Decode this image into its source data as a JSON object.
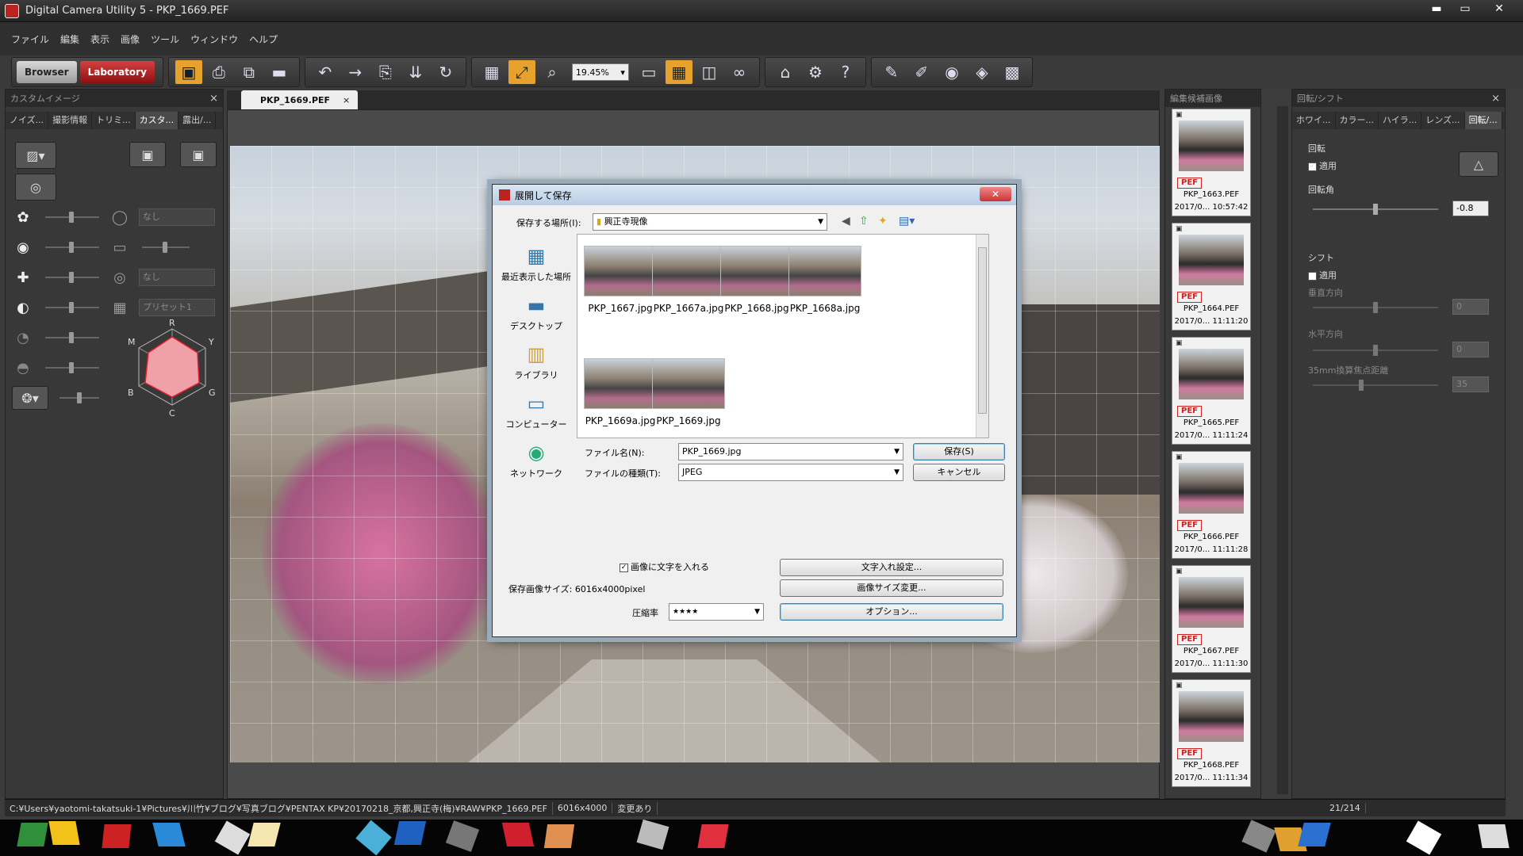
{
  "window": {
    "title": "Digital Camera Utility 5 - PKP_1669.PEF",
    "min": "▬",
    "max": "▭",
    "close": "✕"
  },
  "menu": [
    "ファイル",
    "編集",
    "表示",
    "画像",
    "ツール",
    "ウィンドウ",
    "ヘルプ"
  ],
  "toolbar": {
    "browser": "Browser",
    "laboratory": "Laboratory",
    "zoom": "19.45%"
  },
  "left_panel": {
    "title": "カスタムイメージ",
    "close": "×",
    "tabs": [
      "ノイズ...",
      "撮影情報",
      "トリミ...",
      "カスタ...",
      "露出/..."
    ],
    "active_tab": 3,
    "rows": [
      {
        "icon": "RGB",
        "select": "なし"
      },
      {
        "icon": "◉",
        "select": ""
      },
      {
        "icon": "✚",
        "select": "なし"
      },
      {
        "icon": "◐",
        "select": "プリセット1"
      },
      {
        "icon": "◔",
        "select": ""
      },
      {
        "icon": "◓",
        "select": ""
      }
    ],
    "radar_labels": {
      "r": "R",
      "y": "Y",
      "g": "G",
      "c": "C",
      "b": "B",
      "m": "M"
    },
    "colors": {
      "radar_fill": "#f0a0a8",
      "radar_line": "#e02030"
    }
  },
  "document_tab": {
    "label": "PKP_1669.PEF",
    "close": "×"
  },
  "dialog": {
    "title": "展開して保存",
    "close": "✕",
    "save_in_label": "保存する場所(I):",
    "save_in_value": "興正寺現像",
    "places": [
      "最近表示した場所",
      "デスクトップ",
      "ライブラリ",
      "コンピューター",
      "ネットワーク"
    ],
    "files": [
      "PKP_1667.jpg",
      "PKP_1667a.jpg",
      "PKP_1668.jpg",
      "PKP_1668a.jpg",
      "PKP_1669a.jpg",
      "PKP_1669.jpg"
    ],
    "filename_label": "ファイル名(N):",
    "filename_value": "PKP_1669.jpg",
    "filetype_label": "ファイルの種類(T):",
    "filetype_value": "JPEG",
    "save_button": "保存(S)",
    "cancel_button": "キャンセル",
    "text_checkbox": "画像に文字を入れる",
    "text_checked": "✓",
    "text_settings_button": "文字入れ設定...",
    "size_label": "保存画像サイズ:",
    "size_value": "6016x4000pixel",
    "resize_button": "画像サイズ変更...",
    "compression_label": "圧縮率",
    "compression_value": "★★★★",
    "options_button": "オプション..."
  },
  "filmstrip": {
    "title": "編集候補画像",
    "items": [
      {
        "name": "PKP_1663.PEF",
        "date": "2017/0...  10:57:42",
        "badge": "PEF"
      },
      {
        "name": "PKP_1664.PEF",
        "date": "2017/0...  11:11:20",
        "badge": "PEF"
      },
      {
        "name": "PKP_1665.PEF",
        "date": "2017/0...  11:11:24",
        "badge": "PEF"
      },
      {
        "name": "PKP_1666.PEF",
        "date": "2017/0...  11:11:28",
        "badge": "PEF"
      },
      {
        "name": "PKP_1667.PEF",
        "date": "2017/0...  11:11:30",
        "badge": "PEF"
      },
      {
        "name": "PKP_1668.PEF",
        "date": "2017/0...  11:11:34",
        "badge": "PEF"
      }
    ]
  },
  "right_panel": {
    "title": "回転/シフト",
    "close": "×",
    "tabs": [
      "ホワイ...",
      "カラー...",
      "ハイラ...",
      "レンズ...",
      "回転/..."
    ],
    "active_tab": 4,
    "rotate": {
      "section": "回転",
      "apply": "適用",
      "apply_checked": "✓",
      "angle_label": "回転角",
      "angle_value": "-0.8"
    },
    "shift": {
      "section": "シフト",
      "apply": "適用",
      "vertical_label": "垂直方向",
      "vertical_value": "0",
      "horizontal_label": "水平方向",
      "horizontal_value": "0",
      "focal_label": "35mm換算焦点距離",
      "focal_value": "35"
    }
  },
  "status": {
    "path": "C:¥Users¥yaotomi-takatsuki-1¥Pictures¥川竹¥ブログ¥写真ブログ¥PENTAX KP¥20170218_京都,興正寺(梅)¥RAW¥PKP_1669.PEF",
    "dimensions": "6016x4000",
    "state": "変更あり",
    "count": "21/214"
  }
}
